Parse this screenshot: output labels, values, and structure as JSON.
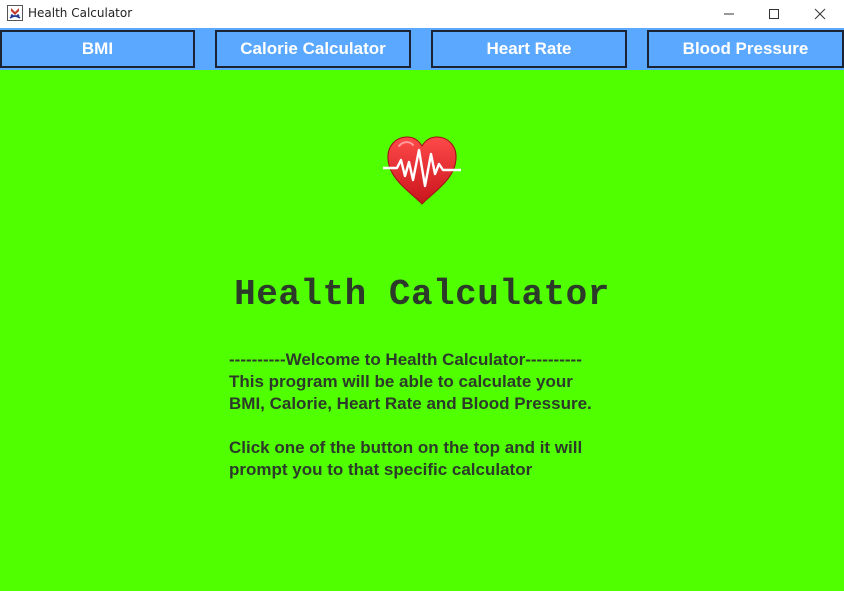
{
  "window": {
    "title": "Health Calculator",
    "controls": {
      "minimize": "minimize-icon",
      "maximize": "maximize-icon",
      "close": "close-icon"
    }
  },
  "nav": {
    "items": [
      {
        "label": "BMI"
      },
      {
        "label": "Calorie Calculator"
      },
      {
        "label": "Heart Rate"
      },
      {
        "label": "Blood Pressure"
      }
    ]
  },
  "main": {
    "logo_icon": "heart-pulse-icon",
    "title": "Health Calculator",
    "description": [
      "----------Welcome to Health Calculator----------",
      "This program will be able to calculate your",
      "BMI, Calorie, Heart Rate and Blood Pressure.",
      "",
      "Click one of the button on the top and it will",
      "prompt you to that specific calculator"
    ]
  },
  "colors": {
    "background": "#50ff00",
    "nav_button": "#5aa8ff",
    "nav_text": "#ffffff",
    "text": "#2c3a2a",
    "heart": "#e8262c"
  }
}
